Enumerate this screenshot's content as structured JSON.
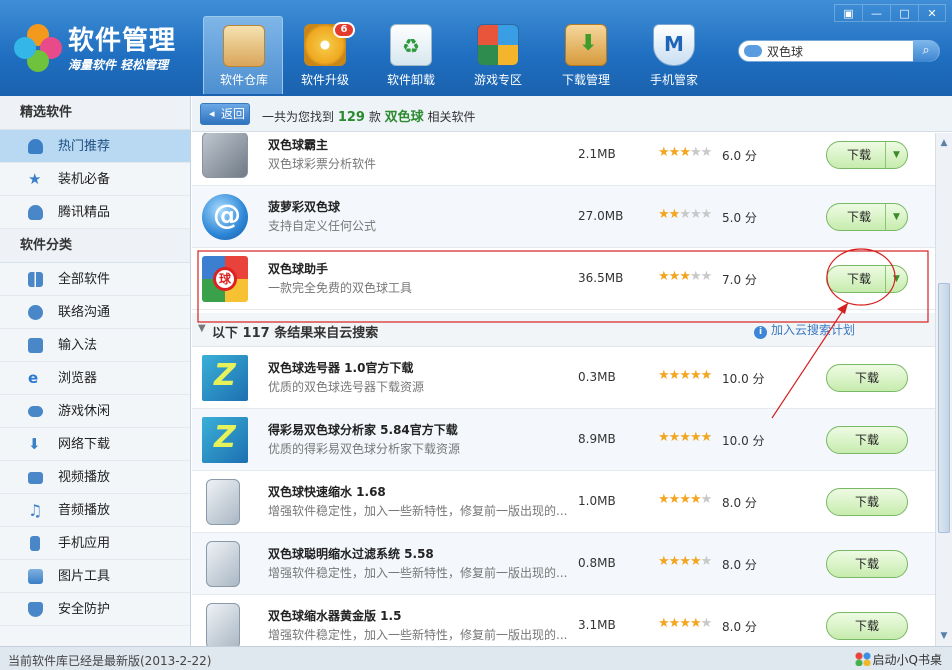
{
  "app": {
    "title": "软件管理",
    "slogan": "海量软件 轻松管理"
  },
  "window_controls": {
    "menu": "▣",
    "minimize": "—",
    "maximize": "□",
    "close": "✕"
  },
  "nav": [
    {
      "label": "软件仓库",
      "icon": "disc-box-icon",
      "active": true
    },
    {
      "label": "软件升级",
      "icon": "upgrade-disc-icon",
      "badge": "6"
    },
    {
      "label": "软件卸载",
      "icon": "recycle-bin-icon"
    },
    {
      "label": "游戏专区",
      "icon": "games-grid-icon"
    },
    {
      "label": "下载管理",
      "icon": "download-box-icon"
    },
    {
      "label": "手机管家",
      "icon": "phone-shield-icon"
    }
  ],
  "search": {
    "value": "双色球",
    "button": "⌕"
  },
  "sidebar": {
    "section1": "精选软件",
    "items1": [
      {
        "label": "热门推荐",
        "icon": "hand-pointer-icon",
        "active": true
      },
      {
        "label": "装机必备",
        "icon": "star-icon"
      },
      {
        "label": "腾讯精品",
        "icon": "penguin-icon"
      }
    ],
    "section2": "软件分类",
    "items2": [
      {
        "label": "全部软件",
        "icon": "grid-icon"
      },
      {
        "label": "联络沟通",
        "icon": "chat-bubble-icon"
      },
      {
        "label": "输入法",
        "icon": "keyboard-icon"
      },
      {
        "label": "浏览器",
        "icon": "browser-e-icon"
      },
      {
        "label": "游戏休闲",
        "icon": "gamepad-icon"
      },
      {
        "label": "网络下载",
        "icon": "download-icon"
      },
      {
        "label": "视频播放",
        "icon": "tv-icon"
      },
      {
        "label": "音频播放",
        "icon": "music-note-icon"
      },
      {
        "label": "手机应用",
        "icon": "mobile-icon"
      },
      {
        "label": "图片工具",
        "icon": "picture-icon"
      },
      {
        "label": "安全防护",
        "icon": "shield-icon"
      }
    ]
  },
  "topbar": {
    "back": "返回",
    "prefix": "一共为您找到",
    "count": "129",
    "unit": "款",
    "keyword": "双色球",
    "suffix": "相关软件"
  },
  "results": [
    {
      "name": "双色球霸主",
      "desc": "双色球彩票分析软件",
      "size": "2.1MB",
      "stars": 3,
      "score": "6.0 分",
      "download": "下载",
      "icon": "lottery-pc-icon"
    },
    {
      "name": "菠萝彩双色球",
      "desc": "支持自定义任何公式",
      "size": "27.0MB",
      "stars": 2,
      "score": "5.0 分",
      "download": "下载",
      "icon": "blue-at-icon"
    },
    {
      "name": "双色球助手",
      "desc": "一款完全免费的双色球工具",
      "size": "36.5MB",
      "stars": 3,
      "score": "7.0 分",
      "download": "下载",
      "icon": "ball-target-icon"
    }
  ],
  "cloud": {
    "title": "以下 117 条结果来自云搜索",
    "plan": "加入云搜索计划",
    "info": "i"
  },
  "cloud_results": [
    {
      "name": "双色球选号器 1.0官方下载",
      "desc": "优质的双色球选号器下载资源",
      "size": "0.3MB",
      "stars": 5,
      "score": "10.0 分",
      "download": "下载",
      "icon": "z-icon"
    },
    {
      "name": "得彩易双色球分析家 5.84官方下载",
      "desc": "优质的得彩易双色球分析家下载资源",
      "size": "8.9MB",
      "stars": 5,
      "score": "10.0 分",
      "download": "下载",
      "icon": "z-icon"
    },
    {
      "name": "双色球快速缩水 1.68",
      "desc": "增强软件稳定性，加入一些新特性，修复前一版出现的...",
      "size": "1.0MB",
      "stars": 4,
      "score": "8.0 分",
      "download": "下载",
      "icon": "installer-icon"
    },
    {
      "name": "双色球聪明缩水过滤系统 5.58",
      "desc": "增强软件稳定性，加入一些新特性，修复前一版出现的...",
      "size": "0.8MB",
      "stars": 4,
      "score": "8.0 分",
      "download": "下载",
      "icon": "installer-icon"
    },
    {
      "name": "双色球缩水器黄金版 1.5",
      "desc": "增强软件稳定性，加入一些新特性，修复前一版出现的...",
      "size": "3.1MB",
      "stars": 4,
      "score": "8.0 分",
      "download": "下载",
      "icon": "installer-icon"
    }
  ],
  "status": {
    "text": "当前软件库已经是最新版(2013-2-22)",
    "qdesk": "启动小Q书桌"
  },
  "colors": {
    "header": "#1f6ec0",
    "accent_green": "#2c8a2f",
    "annotation": "#d62020",
    "link": "#3a78c0",
    "star": "#f2a51f"
  }
}
